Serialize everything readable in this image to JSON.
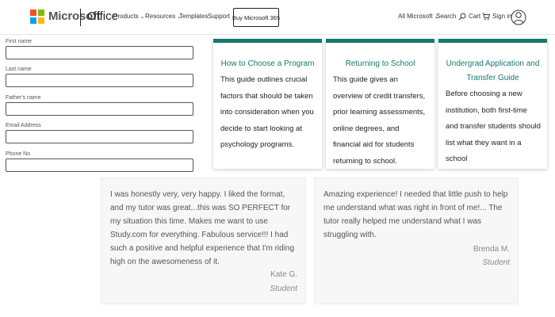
{
  "header": {
    "brand": "Microsoft",
    "product": "Office",
    "nav": [
      {
        "label": "Products",
        "has_dropdown": true
      },
      {
        "label": "Resources",
        "has_dropdown": true
      },
      {
        "label": "Templates",
        "has_dropdown": false
      },
      {
        "label": "Support",
        "has_dropdown": false
      }
    ],
    "buy_button": "Buy Microsoft 365",
    "all_microsoft": "All Microsoft",
    "search": "Search",
    "cart": "Cart",
    "sign_in": "Sign in",
    "logo_colors": [
      "#f25022",
      "#7fba00",
      "#00a4ef",
      "#ffb900"
    ]
  },
  "form": {
    "fields": [
      {
        "label": "First name",
        "value": ""
      },
      {
        "label": "Last name",
        "value": ""
      },
      {
        "label": "Father's name",
        "value": ""
      },
      {
        "label": "Email Address",
        "value": ""
      },
      {
        "label": "Phone No",
        "value": ""
      }
    ]
  },
  "guides": [
    {
      "title": "How to Choose a Program",
      "body": "This guide outlines crucial factors that should be taken into consideration when you decide to start looking at psychology programs."
    },
    {
      "title": "Returning to School",
      "body": "This guide gives an overview of credit transfers, prior learning assessments, online degrees, and financial aid for students returning to school."
    },
    {
      "title": "Undergrad Application and Transfer Guide",
      "body": "Before choosing a new institution, both first-time and transfer students should list what they want in a school"
    }
  ],
  "testimonials": [
    {
      "quote": "I was honestly very, very happy. I liked the format, and my tutor was great...this was SO PERFECT for my situation this time. Makes me want to use Study.com for everything. Fabulous service!!! I had such a positive and helpful experience that I'm riding high on the awesomeness of it.",
      "name": "Kate G.",
      "role": "Student"
    },
    {
      "quote": "Amazing experience! I needed that little push to help me understand what was right in front of me!... The tutor really helped me understand what I was struggling with.",
      "name": "Brenda M.",
      "role": "Student"
    }
  ],
  "colors": {
    "accent": "#157a6e",
    "testimonial_bg": "#f7f7f7"
  }
}
